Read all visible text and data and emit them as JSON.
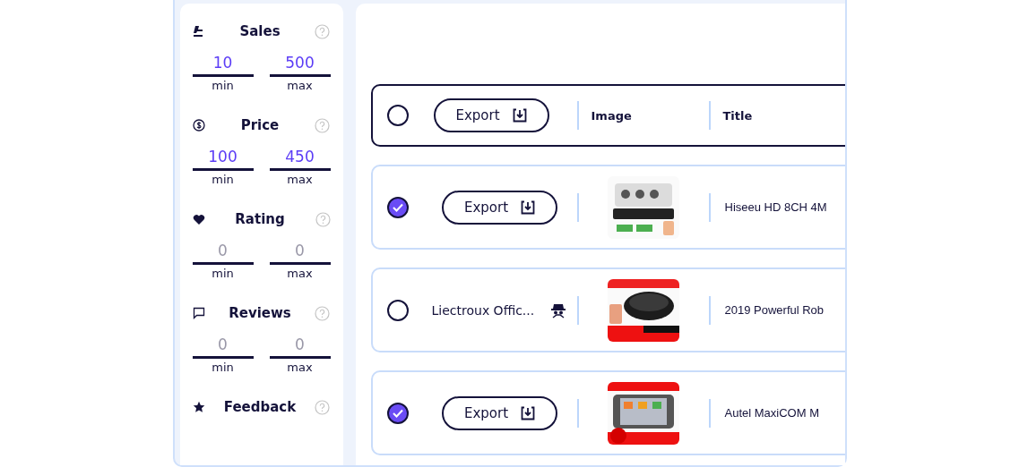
{
  "filters": [
    {
      "title": "Sales",
      "min": {
        "value": "10",
        "label": "min"
      },
      "max": {
        "value": "500",
        "label": "max"
      }
    },
    {
      "title": "Price",
      "min": {
        "value": "100",
        "label": "min"
      },
      "max": {
        "value": "450",
        "label": "max"
      }
    },
    {
      "title": "Rating",
      "min": {
        "placeholder": "0",
        "label": "min"
      },
      "max": {
        "placeholder": "0",
        "label": "max"
      }
    },
    {
      "title": "Reviews",
      "min": {
        "placeholder": "0",
        "label": "min"
      },
      "max": {
        "placeholder": "0",
        "label": "max"
      }
    },
    {
      "title": "Feedback"
    }
  ],
  "table": {
    "header": {
      "selected": false,
      "export": "Export",
      "columns": [
        "Image",
        "Title"
      ]
    },
    "rows": [
      {
        "selected": true,
        "kind": "export",
        "export": "Export",
        "title": "Hiseeu HD 8CH 4M"
      },
      {
        "selected": false,
        "kind": "store",
        "store": "Liectroux Offic...",
        "title": "2019 Powerful Rob"
      },
      {
        "selected": true,
        "kind": "export",
        "export": "Export",
        "title": "Autel MaxiCOM M"
      }
    ]
  }
}
